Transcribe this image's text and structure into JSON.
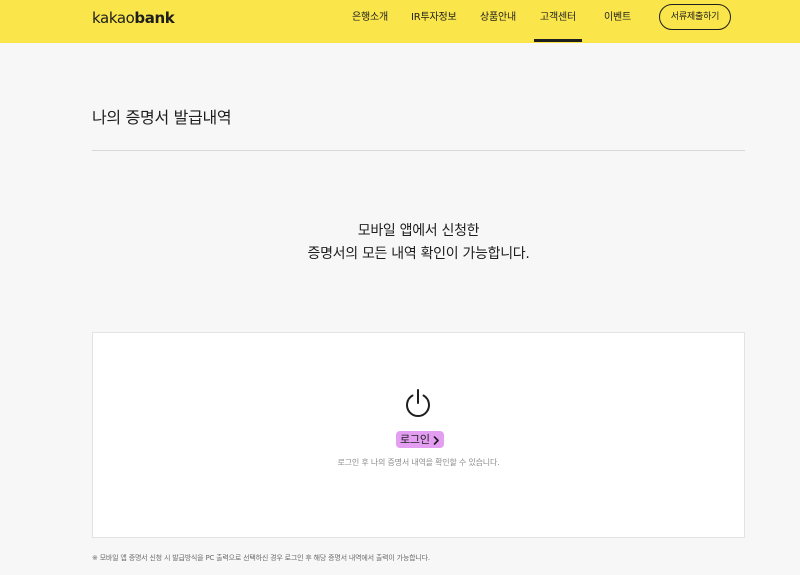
{
  "header": {
    "logo": {
      "part1": "kakao",
      "part2": "bank"
    },
    "nav": [
      {
        "label": "은행소개"
      },
      {
        "label": "IR투자정보"
      },
      {
        "label": "상품안내"
      },
      {
        "label": "고객센터",
        "active": true
      },
      {
        "label": "이벤트"
      }
    ],
    "submit_button": "서류제출하기"
  },
  "page": {
    "title": "나의 증명서 발급내역",
    "intro_line1": "모바일 앱에서 신청한",
    "intro_line2": "증명서의 모든 내역 확인이 가능합니다."
  },
  "login_panel": {
    "icon": "power-icon",
    "login_label": "로그인",
    "description": "로그인 후 나의 증명서 내역을 확인할 수 있습니다."
  },
  "footnote": "※ 모바일 앱 증명서 신청 시 발급방식을 PC 출력으로 선택하신 경우 로그인 후 해당 증명서 내역에서 출력이 가능합니다.",
  "colors": {
    "brand_yellow": "#fae54b",
    "highlight_pink": "#e39ef2"
  }
}
